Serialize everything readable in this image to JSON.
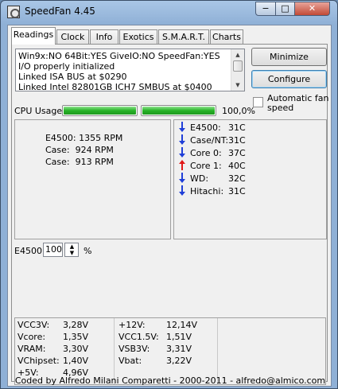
{
  "window": {
    "title": "SpeedFan 4.45",
    "min_label": "−",
    "max_label": "□",
    "close_label": "✕"
  },
  "tabs": [
    "Readings",
    "Clock",
    "Info",
    "Exotics",
    "S.M.A.R.T.",
    "Charts"
  ],
  "log_lines": [
    "Win9x:NO  64Bit:YES  GiveIO:NO  SpeedFan:YES",
    "I/O properly initialized",
    "Linked ISA BUS at $0290",
    "Linked Intel 82801GB ICH7 SMBUS at $0400"
  ],
  "buttons": {
    "minimize": "Minimize",
    "configure": "Configure"
  },
  "auto_fan": {
    "label": "Automatic fan speed",
    "checked": false
  },
  "cpu": {
    "label": "CPU Usage",
    "percent_text": "100,0%",
    "bar1_level": 1.0,
    "bar2_level": 1.0
  },
  "fans": [
    {
      "label": "E4500:",
      "value": "1355 RPM"
    },
    {
      "label": "Case:",
      "value": "924 RPM"
    },
    {
      "label": "Case:",
      "value": "913 RPM"
    }
  ],
  "temps": [
    {
      "label": "E4500:",
      "value": "31C",
      "trend": "down",
      "color": "#1f3fd8"
    },
    {
      "label": "Case/NT:",
      "value": "31C",
      "trend": "down",
      "color": "#1f3fd8"
    },
    {
      "label": "Core 0:",
      "value": "37C",
      "trend": "down",
      "color": "#1f3fd8"
    },
    {
      "label": "Core 1:",
      "value": "40C",
      "trend": "up",
      "color": "#e01818"
    },
    {
      "label": "WD:",
      "value": "32C",
      "trend": "down",
      "color": "#1f3fd8"
    },
    {
      "label": "Hitachi:",
      "value": "31C",
      "trend": "down",
      "color": "#1f3fd8"
    }
  ],
  "fan_control": {
    "label": "E4500:",
    "value": "100",
    "unit": "%"
  },
  "voltages_left": [
    {
      "label": "VCC3V:",
      "value": "3,28V"
    },
    {
      "label": "Vcore:",
      "value": "1,35V"
    },
    {
      "label": "VRAM:",
      "value": "3,30V"
    },
    {
      "label": "VChipset:",
      "value": "1,40V"
    },
    {
      "label": "+5V:",
      "value": "4,96V"
    }
  ],
  "voltages_right": [
    {
      "label": "+12V:",
      "value": "12,14V"
    },
    {
      "label": "VCC1.5V:",
      "value": "1,51V"
    },
    {
      "label": "VSB3V:",
      "value": "3,31V"
    },
    {
      "label": "Vbat:",
      "value": "3,22V"
    }
  ],
  "footer": "Coded by Alfredo Milani Comparetti - 2000-2011 - alfredo@almico.com"
}
